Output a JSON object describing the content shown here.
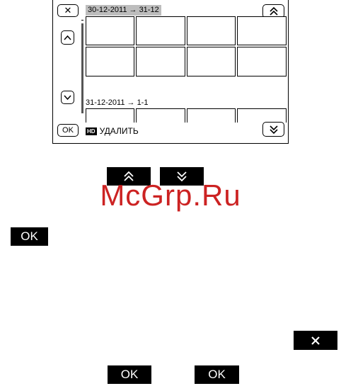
{
  "screen": {
    "close_label": "✕",
    "ok_label": "OK",
    "group_1_date": "30-12-2011 → 31-12",
    "group_2_date": "31-12-2011 → 1-1",
    "hd_badge": "HD",
    "delete_label": "УДАЛИТЬ"
  },
  "manual": {
    "ok_label": "OK"
  },
  "watermark": "McGrp.Ru"
}
